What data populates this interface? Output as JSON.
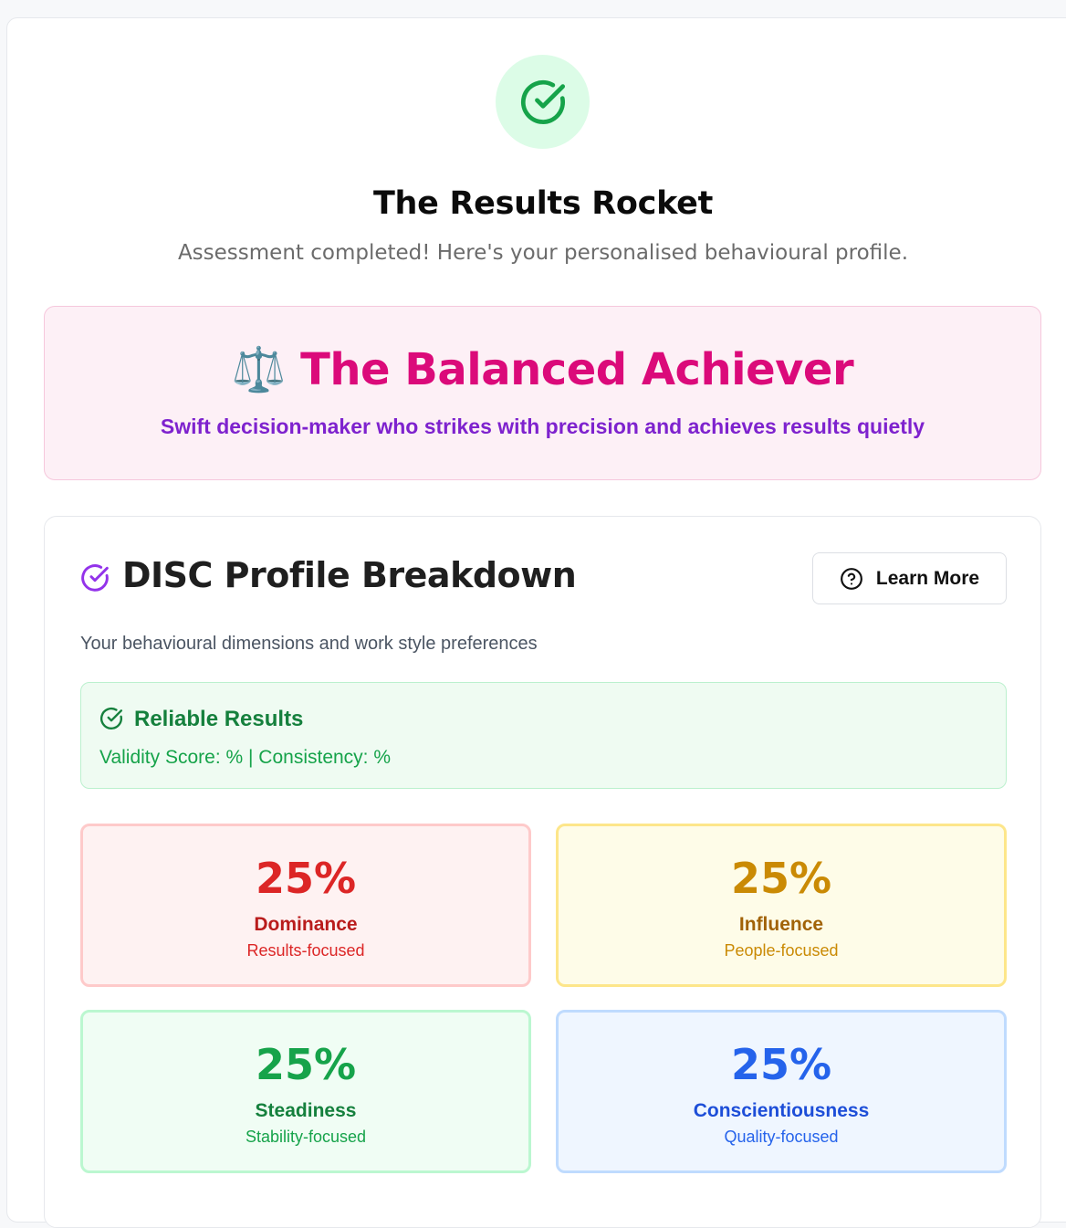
{
  "header": {
    "icon": "check-circle-icon",
    "title": "The Results Rocket",
    "subtitle": "Assessment completed! Here's your personalised behavioural profile."
  },
  "profile": {
    "emoji": "⚖️",
    "name": "The Balanced Achiever",
    "description": "Swift decision-maker who strikes with precision and achieves results quietly",
    "accent_color": "#db0a7a",
    "description_color": "#7e22ce"
  },
  "disc": {
    "icon": "check-circle-icon",
    "title": "DISC Profile Breakdown",
    "learn_more_label": "Learn More",
    "learn_more_icon": "question-circle-icon",
    "subtitle": "Your behavioural dimensions and work style preferences",
    "reliability": {
      "icon": "check-circle-icon",
      "title": "Reliable Results",
      "text": "Validity Score: % | Consistency: %"
    },
    "dimensions": [
      {
        "percent": "25%",
        "name": "Dominance",
        "focus": "Results-focused",
        "color": "#dc2626"
      },
      {
        "percent": "25%",
        "name": "Influence",
        "focus": "People-focused",
        "color": "#ca8a04"
      },
      {
        "percent": "25%",
        "name": "Steadiness",
        "focus": "Stability-focused",
        "color": "#16a34a"
      },
      {
        "percent": "25%",
        "name": "Conscientiousness",
        "focus": "Quality-focused",
        "color": "#2563eb"
      }
    ]
  }
}
